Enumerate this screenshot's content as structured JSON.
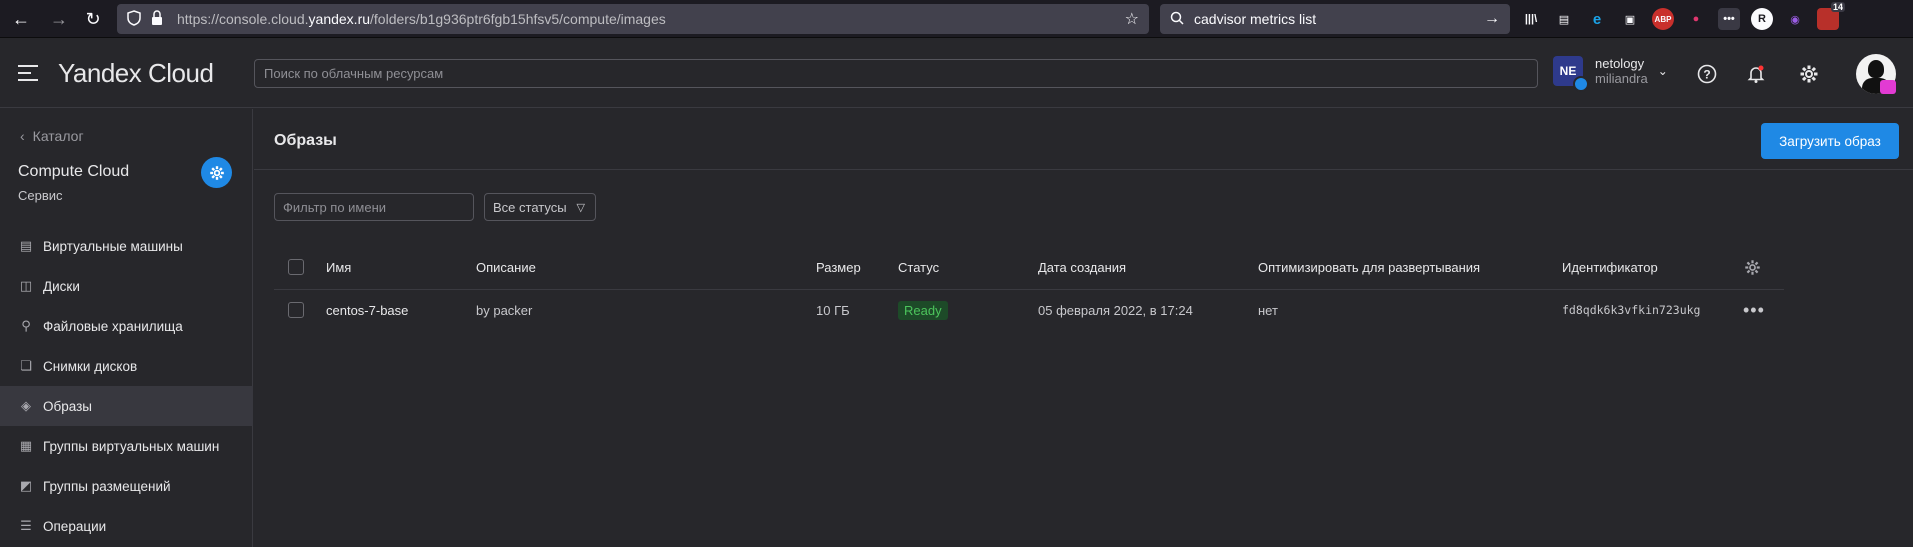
{
  "browser": {
    "back_icon": "←",
    "forward_icon": "→",
    "reload_icon": "↻",
    "url_prefix": "https://console.cloud.",
    "url_host": "yandex.ru",
    "url_path": "/folders/b1g936ptr6fgb15hfsv5/compute/images",
    "search_value": "cadvisor metrics list",
    "ext_badge_count": "14",
    "extensions": [
      "|||\\",
      "▤",
      "e",
      "▣",
      "ABP",
      "●",
      "•••",
      "R",
      "◉"
    ]
  },
  "header": {
    "logo_part1": "Yandex",
    "logo_part2": " Cloud",
    "search_placeholder": "Поиск по облачным ресурсам",
    "account_initials": "NE",
    "account_name": "netology",
    "account_org": "miliandra",
    "chevron": "⌄"
  },
  "sidebar": {
    "back_label": "Каталог",
    "service_title": "Compute Cloud",
    "service_subtitle": "Сервис",
    "items": [
      {
        "label": "Виртуальные машины",
        "icon": "▤"
      },
      {
        "label": "Диски",
        "icon": "◫"
      },
      {
        "label": "Файловые хранилища",
        "icon": "⚲"
      },
      {
        "label": "Снимки дисков",
        "icon": "❏"
      },
      {
        "label": "Образы",
        "icon": "◈"
      },
      {
        "label": "Группы виртуальных машин",
        "icon": "▦"
      },
      {
        "label": "Группы размещений",
        "icon": "◩"
      },
      {
        "label": "Операции",
        "icon": "☰"
      }
    ],
    "active_index": 4
  },
  "main": {
    "title": "Образы",
    "upload_label": "Загрузить образ",
    "filter_placeholder": "Фильтр по имени",
    "status_filter": "Все статусы",
    "columns": [
      "Имя",
      "Описание",
      "Размер",
      "Статус",
      "Дата создания",
      "Оптимизировать для развертывания",
      "Идентификатор"
    ],
    "rows": [
      {
        "name": "centos-7-base",
        "description": "by packer",
        "size": "10 ГБ",
        "status": "Ready",
        "created": "05 февраля 2022, в 17:24",
        "optimize": "нет",
        "id": "fd8qdk6k3vfkin723ukg"
      }
    ]
  },
  "colors": {
    "accent": "#1f89e5",
    "background": "#27272b",
    "ready_text": "#4cc45c",
    "ready_bg": "#1d4a28"
  }
}
